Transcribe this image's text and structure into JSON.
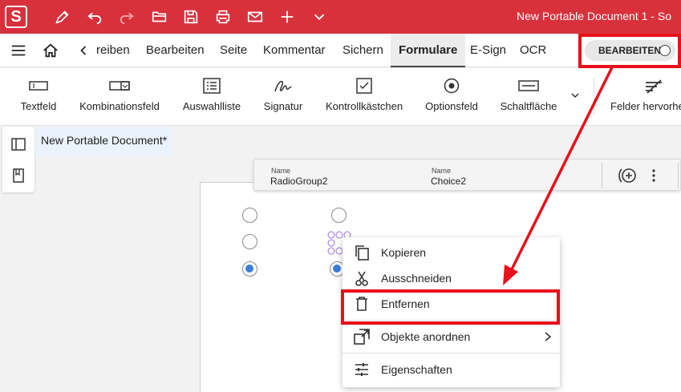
{
  "app": {
    "logo_letter": "S",
    "document_title": "New Portable Document 1 - So"
  },
  "menubar": {
    "items": [
      "reiben",
      "Bearbeiten",
      "Seite",
      "Kommentar",
      "Sichern",
      "Formulare",
      "E-Sign",
      "OCR"
    ],
    "active": "Formulare",
    "edit_toggle_label": "BEARBEITEN"
  },
  "ribbon": {
    "buttons": [
      "Textfeld",
      "Kombinationsfeld",
      "Auswahlliste",
      "Signatur",
      "Kontrollkästchen",
      "Optionsfeld",
      "Schaltfläche",
      "Felder hervorhe"
    ]
  },
  "document": {
    "tab_label": "New Portable Document*"
  },
  "properties": {
    "field1_label": "Name",
    "field1_value": "RadioGroup2",
    "field2_label": "Name",
    "field2_value": "Choice2"
  },
  "context_menu": {
    "items": [
      "Kopieren",
      "Ausschneiden",
      "Entfernen",
      "Objekte anordnen",
      "Eigenschaften"
    ]
  },
  "colors": {
    "title_bar": "#d9313c",
    "highlight": "#e8101a",
    "radio_checked": "#3b7dd8"
  }
}
